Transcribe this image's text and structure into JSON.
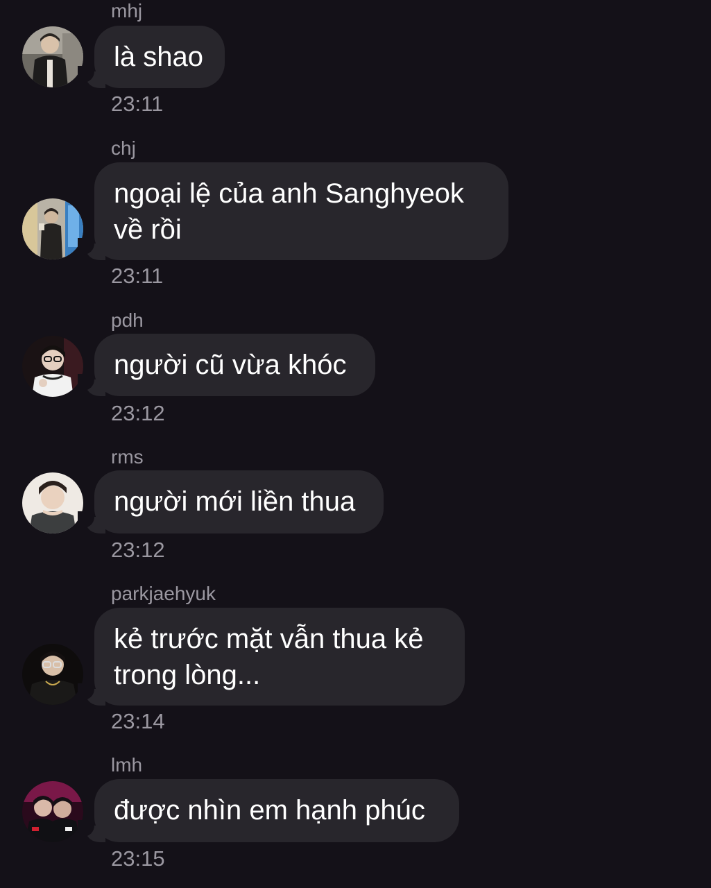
{
  "messages": [
    {
      "sender": "mhj",
      "text": "là shao",
      "time": "23:11",
      "avatar": "avatar-photo-icon"
    },
    {
      "sender": "chj",
      "text": "ngoại lệ của anh Sanghyeok\nvề rồi",
      "time": "23:11",
      "avatar": "avatar-photo-icon"
    },
    {
      "sender": "pdh",
      "text": "người cũ vừa khóc",
      "time": "23:12",
      "avatar": "avatar-photo-icon"
    },
    {
      "sender": "rms",
      "text": "người mới liền thua",
      "time": "23:12",
      "avatar": "avatar-photo-icon"
    },
    {
      "sender": "parkjaehyuk",
      "text": "kẻ trước mặt vẫn thua kẻ\ntrong lòng...",
      "time": "23:14",
      "avatar": "avatar-photo-icon"
    },
    {
      "sender": "lmh",
      "text": "được nhìn em hạnh phúc",
      "time": "23:15",
      "avatar": "avatar-photo-icon"
    }
  ],
  "colors": {
    "background": "#141118",
    "bubble": "#28262c",
    "meta_text": "#9b98a1",
    "message_text": "#ffffff"
  }
}
